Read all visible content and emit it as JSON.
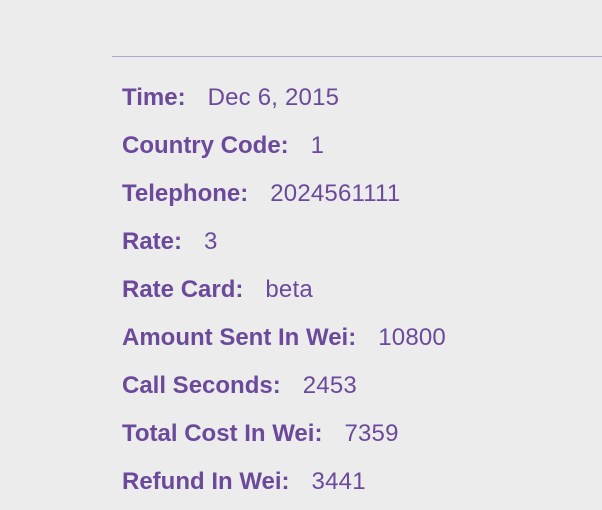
{
  "details": [
    {
      "label": "Time:",
      "value": "Dec 6, 2015"
    },
    {
      "label": "Country Code:",
      "value": "1"
    },
    {
      "label": "Telephone:",
      "value": "2024561111"
    },
    {
      "label": "Rate:",
      "value": "3"
    },
    {
      "label": "Rate Card:",
      "value": "beta"
    },
    {
      "label": "Amount Sent In Wei:",
      "value": "10800"
    },
    {
      "label": "Call Seconds:",
      "value": "2453"
    },
    {
      "label": "Total Cost In Wei:",
      "value": "7359"
    },
    {
      "label": "Refund In Wei:",
      "value": "3441"
    }
  ]
}
